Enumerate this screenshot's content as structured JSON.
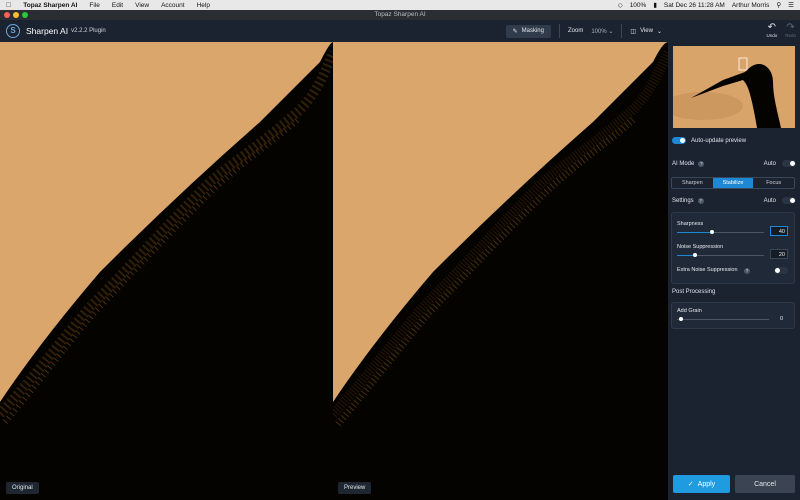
{
  "menubar": {
    "app_name": "Topaz Sharpen AI",
    "items": [
      "File",
      "Edit",
      "View",
      "Account",
      "Help"
    ],
    "battery": "100%",
    "datetime": "Sat Dec 26  11:28 AM",
    "user": "Arthur Morris"
  },
  "window": {
    "title": "Topaz Sharpen AI"
  },
  "toolbar": {
    "app_name": "Sharpen AI",
    "version": "v2.2.2 Plugin",
    "masking_label": "Masking",
    "zoom_label": "Zoom",
    "zoom_value": "100%",
    "view_label": "View"
  },
  "views": {
    "original_label": "Original",
    "preview_label": "Preview"
  },
  "sidebar": {
    "undo_label": "Undo",
    "redo_label": "Redo",
    "auto_update_label": "Auto-update preview",
    "ai_mode": {
      "label": "AI Mode",
      "auto_label": "Auto",
      "tabs": [
        "Sharpen",
        "Stabilize",
        "Focus"
      ],
      "active_tab": "Stabilize"
    },
    "settings": {
      "label": "Settings",
      "auto_label": "Auto",
      "sharpness_label": "Sharpness",
      "sharpness_value": "40",
      "noise_label": "Noise Suppression",
      "noise_value": "20",
      "extra_noise_label": "Extra Noise Suppression"
    },
    "post_processing": {
      "label": "Post Processing",
      "grain_label": "Add Grain",
      "grain_value": "0"
    },
    "apply_label": "Apply",
    "cancel_label": "Cancel"
  },
  "colors": {
    "accent": "#1f88d4",
    "sidebar_bg": "#1b2330",
    "sky": "#d9a56c",
    "toggle_on": "#1f88d4",
    "toggle_off": "#2b3442"
  }
}
